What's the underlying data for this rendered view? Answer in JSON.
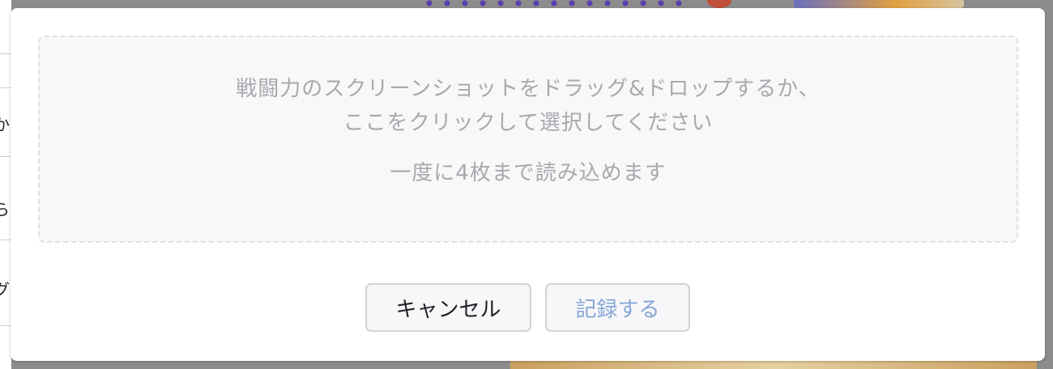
{
  "dialog": {
    "dropzone": {
      "line1": "戦闘力のスクリーンショットをドラッグ&ドロップするか、",
      "line2": "ここをクリックして選択してください",
      "note": "一度に4枚まで読み込めます"
    },
    "buttons": {
      "cancel_label": "キャンセル",
      "record_label": "記録する"
    }
  },
  "background": {
    "edge_glyphs": [
      "か",
      "ら",
      "グ"
    ]
  },
  "colors": {
    "dropzone_text": "#a8a8ae",
    "record_button_text": "#86a6d6",
    "cancel_button_text": "#1f1f24"
  }
}
